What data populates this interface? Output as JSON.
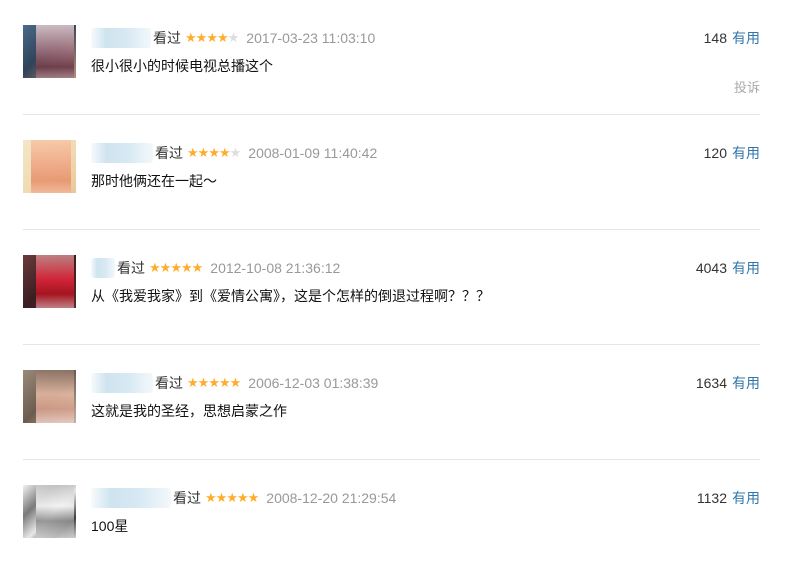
{
  "colors": {
    "star": "#ffac2d",
    "star_empty": "#dddddd",
    "time": "#999999",
    "link": "#3377aa",
    "divider": "#e5e5e5"
  },
  "comments": [
    {
      "action": "看过",
      "rating": 4,
      "time": "2017-03-23 11:03:10",
      "votes": "148",
      "useful_label": "有用",
      "text": "很小很小的时候电视总播这个",
      "report_label": "投诉"
    },
    {
      "action": "看过",
      "rating": 4,
      "time": "2008-01-09 11:40:42",
      "votes": "120",
      "useful_label": "有用",
      "text": "那时他俩还在一起～"
    },
    {
      "action": "看过",
      "rating": 5,
      "time": "2012-10-08 21:36:12",
      "votes": "4043",
      "useful_label": "有用",
      "text": "从《我爱我家》到《爱情公寓》，这是个怎样的倒退过程啊？？？"
    },
    {
      "action": "看过",
      "rating": 5,
      "time": "2006-12-03 01:38:39",
      "votes": "1634",
      "useful_label": "有用",
      "text": "这就是我的圣经，思想启蒙之作"
    },
    {
      "action": "看过",
      "rating": 5,
      "time": "2008-12-20 21:29:54",
      "votes": "1132",
      "useful_label": "有用",
      "text": "100星"
    }
  ]
}
